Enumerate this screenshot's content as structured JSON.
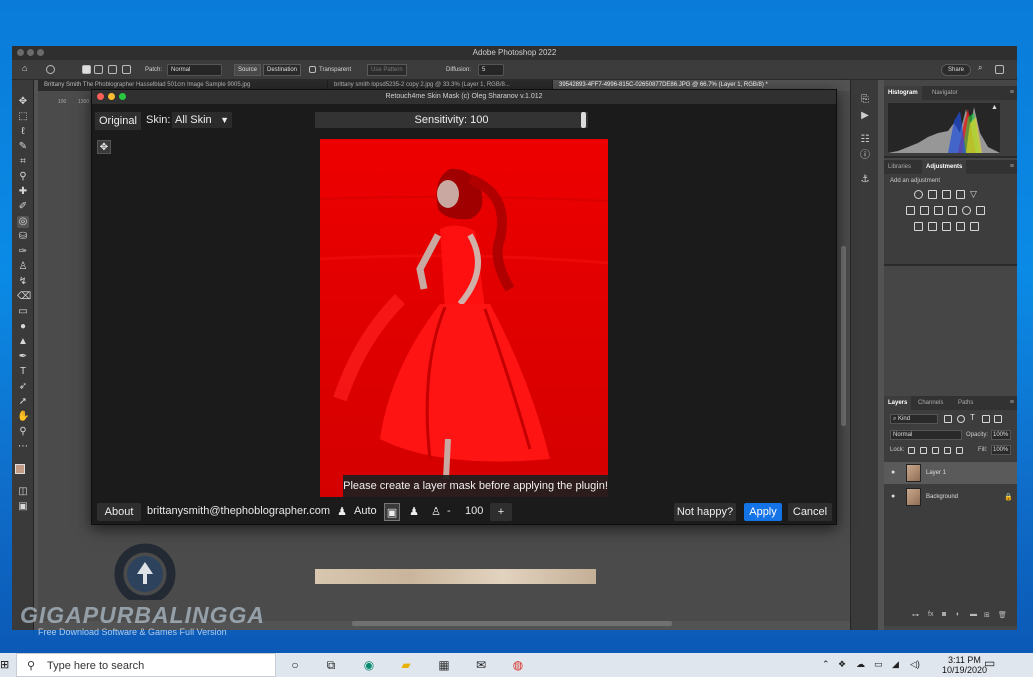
{
  "photoshop": {
    "title": "Adobe Photoshop 2022",
    "options_bar": {
      "patch_label": "Patch:",
      "patch_value": "Normal",
      "source_label": "Source",
      "destination_label": "Destination",
      "transparent_label": "Transparent",
      "use_pattern_label": "Use Pattern",
      "diffusion_label": "Diffusion:",
      "diffusion_value": "5",
      "share_label": "Share"
    },
    "doc_tabs": [
      "Brittany Smith The Phoblographer Hasselblad 501cm Image Sample 9005.jpg",
      "brittany smith lopsd5235-2 copy 2.jpg @ 33.3% (Layer 1, RGB/8...",
      "39542893-4FF7-4996-815C-02650877DE86.JPG @ 66.7% (Layer 1, RGB/8) *"
    ],
    "ruler_labels": [
      "100",
      "1300"
    ],
    "panels": {
      "histogram_tab": "Histogram",
      "navigator_tab": "Navigator",
      "libraries_tab": "Libraries",
      "adjustments_tab": "Adjustments",
      "adjustments_hint": "Add an adjustment",
      "layers_tab": "Layers",
      "channels_tab": "Channels",
      "paths_tab": "Paths",
      "kind_label": "Kind",
      "blend_mode": "Normal",
      "opacity_label": "Opacity:",
      "opacity_value": "100%",
      "lock_label": "Lock:",
      "fill_label": "Fill:",
      "fill_value": "100%",
      "layers": [
        {
          "name": "Layer 1"
        },
        {
          "name": "Background"
        }
      ]
    }
  },
  "plugin": {
    "title": "Retouch4me Skin Mask (c) Oleg Sharanov v.1.012",
    "original_label": "Original",
    "skin_label": "Skin:",
    "skin_value": "All Skin",
    "sensitivity_label": "Sensitivity: 100",
    "warning": "Please create a layer mask before applying the plugin!",
    "about_label": "About",
    "email": "brittanysmith@thephoblographer.com",
    "auto_label": "Auto",
    "minus_label": "-",
    "amount_value": "100",
    "plus_label": "+",
    "not_happy_label": "Not happy?",
    "apply_label": "Apply",
    "cancel_label": "Cancel"
  },
  "watermark": {
    "brand": "GIGAPURBALINGGA",
    "tagline": "Free Download Software & Games Full Version"
  },
  "taskbar": {
    "search_placeholder": "Type here to search",
    "time": "3:11 PM",
    "date": "10/19/2020"
  },
  "colors": {
    "mask_red": "#e50000",
    "apply_blue": "#1473e6",
    "desktop_blue": "#0a7bd8"
  }
}
